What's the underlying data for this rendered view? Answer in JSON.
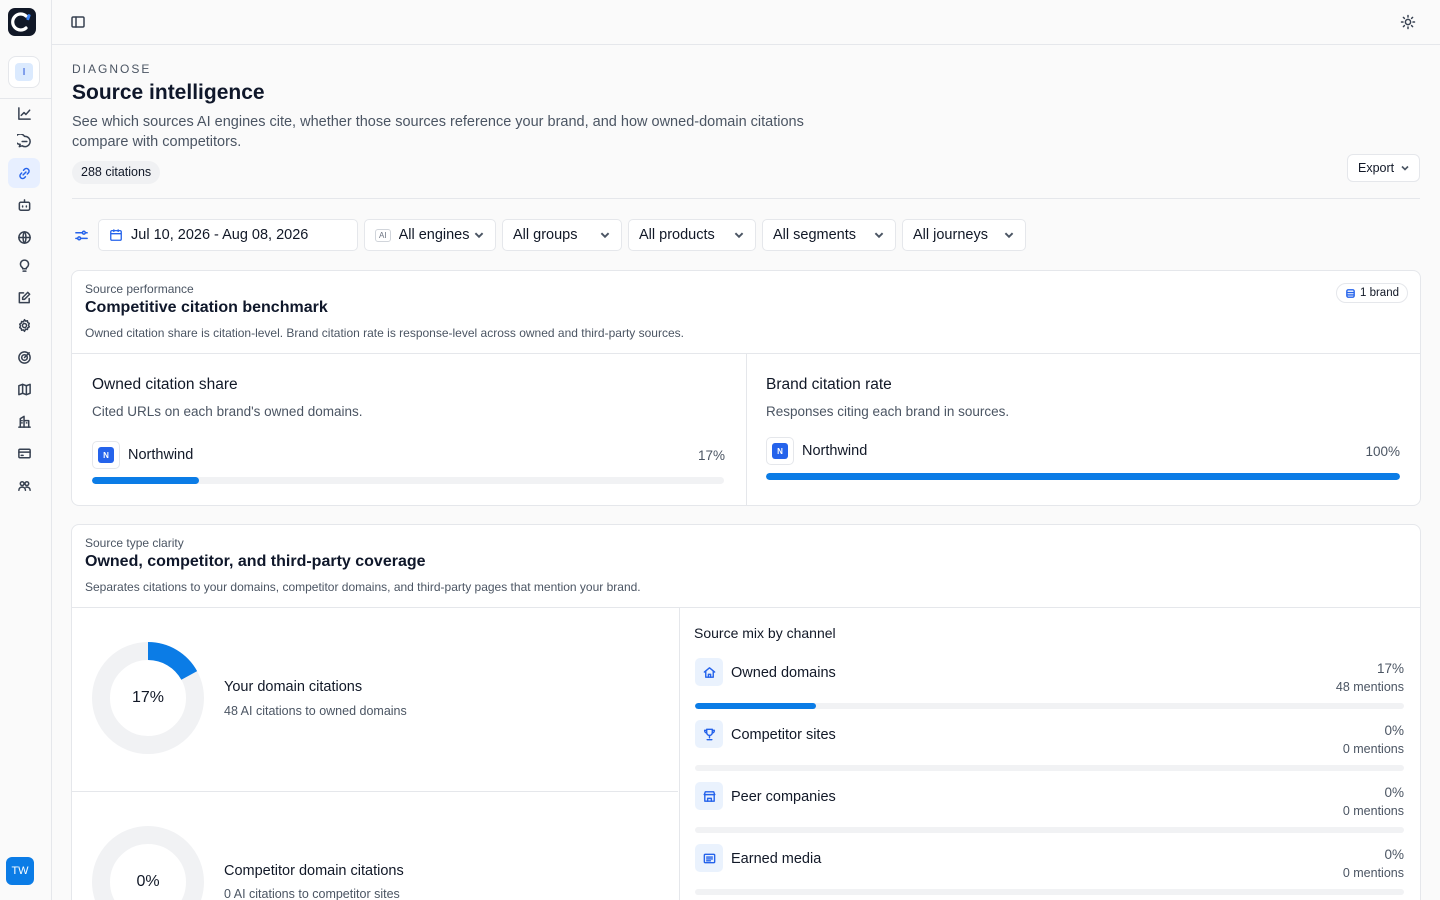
{
  "app": {
    "workspace_initial": "I",
    "user_initials": "TW"
  },
  "nav_icons": [
    "chart-line-icon",
    "chat-icon",
    "link-icon",
    "robot-icon",
    "globe-icon",
    "lightbulb-icon",
    "edit-icon",
    "gear-icon",
    "target-icon",
    "map-icon",
    "building-icon",
    "card-icon",
    "users-icon"
  ],
  "header": {
    "eyebrow": "DIAGNOSE",
    "title": "Source intelligence",
    "description": "See which sources AI engines cite, whether those sources reference your brand, and how owned-domain citations compare with competitors.",
    "citations_pill": "288 citations",
    "export_label": "Export"
  },
  "filters": {
    "date_range": "Jul 10, 2026 - Aug 08, 2026",
    "engines": "All engines",
    "engines_badge": "AI",
    "groups": "All groups",
    "products": "All products",
    "segments": "All segments",
    "journeys": "All journeys"
  },
  "benchmark": {
    "eyebrow": "Source performance",
    "title": "Competitive citation benchmark",
    "description": "Owned citation share is citation-level. Brand citation rate is response-level across owned and third-party sources.",
    "brand_pill": "1 brand",
    "owned_share": {
      "title": "Owned citation share",
      "subtitle": "Cited URLs on each brand's owned domains.",
      "brand": "Northwind",
      "brand_initial": "N",
      "value_label": "17%",
      "value": 0.17
    },
    "citation_rate": {
      "title": "Brand citation rate",
      "subtitle": "Responses citing each brand in sources.",
      "brand": "Northwind",
      "brand_initial": "N",
      "value_label": "100%",
      "value": 1.0
    }
  },
  "coverage": {
    "eyebrow": "Source type clarity",
    "title": "Owned, competitor, and third-party coverage",
    "description": "Separates citations to your domains, competitor domains, and third-party pages that mention your brand.",
    "donuts": [
      {
        "value_label": "17%",
        "value": 0.17,
        "title": "Your domain citations",
        "subtitle": "48 AI citations to owned domains"
      },
      {
        "value_label": "0%",
        "value": 0,
        "title": "Competitor domain citations",
        "subtitle": "0 AI citations to competitor sites"
      }
    ],
    "mix_title": "Source mix by channel",
    "mix": [
      {
        "name": "Owned domains",
        "pct": "17%",
        "count": "48 mentions",
        "value": 0.17,
        "icon": "home-icon"
      },
      {
        "name": "Competitor sites",
        "pct": "0%",
        "count": "0 mentions",
        "value": 0,
        "icon": "trophy-icon"
      },
      {
        "name": "Peer companies",
        "pct": "0%",
        "count": "0 mentions",
        "value": 0,
        "icon": "store-icon"
      },
      {
        "name": "Earned media",
        "pct": "0%",
        "count": "0 mentions",
        "value": 0,
        "icon": "newspaper-icon"
      }
    ]
  },
  "colors": {
    "accent": "#0b7ce6",
    "track": "#f1f2f4"
  }
}
